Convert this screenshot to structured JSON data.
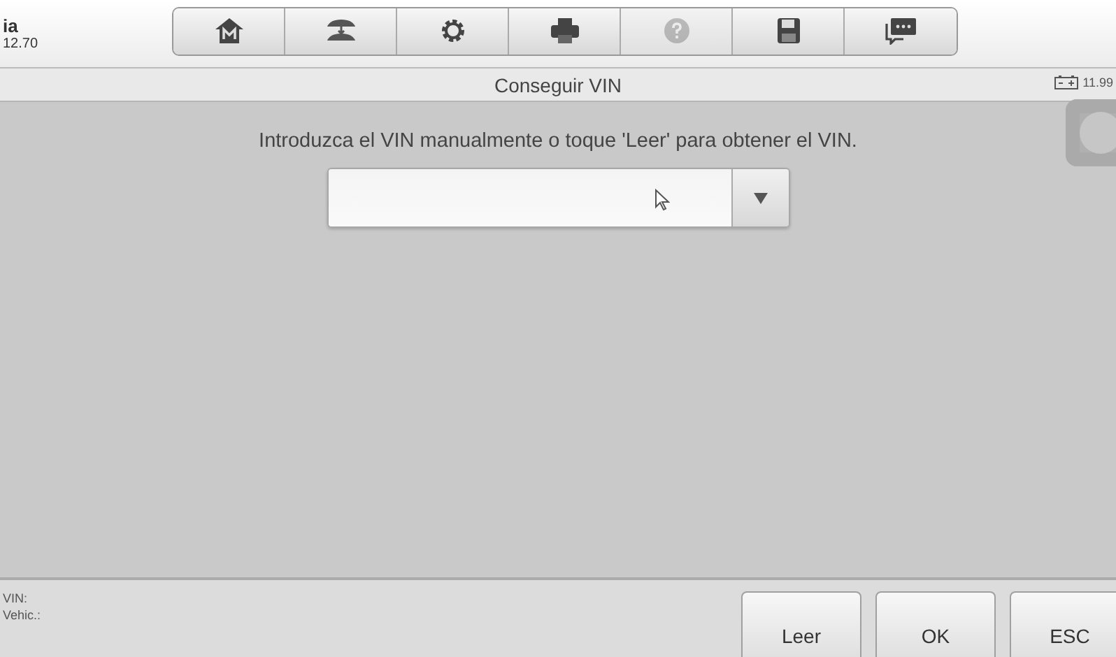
{
  "vehicle": {
    "make": "ia",
    "version": "12.70"
  },
  "toolbar": [
    {
      "kind": "home",
      "disabled": false
    },
    {
      "kind": "vehicles",
      "disabled": false
    },
    {
      "kind": "settings",
      "disabled": false
    },
    {
      "kind": "print",
      "disabled": false
    },
    {
      "kind": "help",
      "disabled": true
    },
    {
      "kind": "save",
      "disabled": false
    },
    {
      "kind": "chat",
      "disabled": false
    }
  ],
  "title_bar": {
    "title": "Conseguir VIN",
    "battery": "11.99"
  },
  "instruction": "Introduzca el VIN manualmente o toque 'Leer' para obtener el VIN.",
  "status": {
    "vin_label": "VIN:",
    "vehicle_label": "Vehic.:"
  },
  "buttons": [
    "Leer",
    "OK",
    "ESC"
  ]
}
